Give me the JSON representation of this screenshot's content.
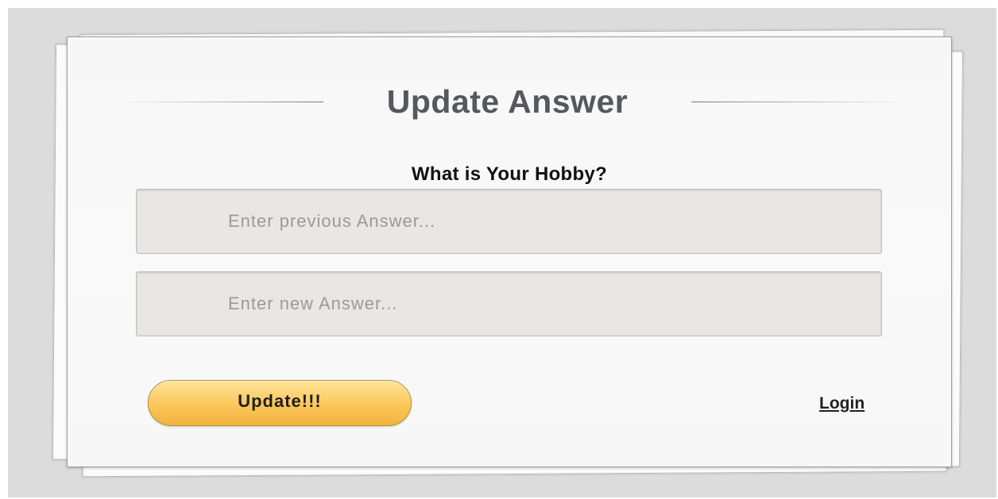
{
  "form": {
    "title": "Update Answer",
    "question": "What is Your Hobby?",
    "previous_answer": {
      "value": "",
      "placeholder": "Enter previous Answer..."
    },
    "new_answer": {
      "value": "",
      "placeholder": "Enter new Answer..."
    },
    "submit_label": "Update!!!",
    "login_link": "Login"
  },
  "colors": {
    "background": "#dcdcdc",
    "card": "#f8f8f8",
    "button_top": "#ffe49a",
    "button_bottom": "#f3b23e",
    "title_text": "#565860"
  }
}
